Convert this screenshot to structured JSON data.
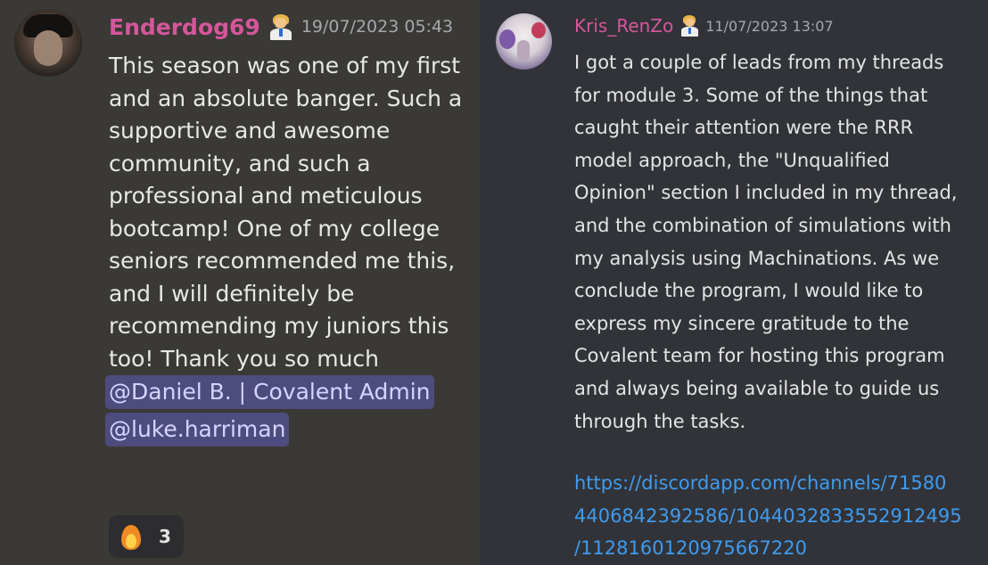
{
  "left_message": {
    "username": "Enderdog69",
    "role_icon": "scientist-emoji-icon",
    "timestamp": "19/07/2023 05:43",
    "body_lines": [
      "This season was one of my first",
      "and an absolute banger. Such a",
      "supportive and awesome",
      "community, and such a",
      "professional and meticulous",
      "bootcamp! One of my college",
      "seniors recommended me this,",
      "and I will definitely be",
      "recommending my juniors this",
      "too! Thank you so much"
    ],
    "mentions": [
      "@Daniel B. | Covalent Admin",
      "@luke.harriman"
    ],
    "reaction": {
      "emoji": "fire-emoji-icon",
      "count": "3"
    }
  },
  "right_message": {
    "username": "Kris_RenZo",
    "role_icon": "scientist-emoji-icon",
    "timestamp": "11/07/2023 13:07",
    "body_lines": [
      "I got a couple of leads from my threads",
      "for module 3. Some of the things that",
      "caught their attention were the RRR",
      "model approach, the \"Unqualified",
      "Opinion\" section I included in my thread,",
      "and the combination of simulations with",
      "my analysis using Machinations. As we",
      "conclude the program, I would like to",
      "express my sincere gratitude to the",
      "Covalent team for hosting this program",
      "and always being available to guide us",
      "through the tasks."
    ],
    "link_lines": [
      "https://discordapp.com/channels/71580",
      "4406842392586/1044032833552912495",
      "/1128160120975667220"
    ]
  },
  "colors": {
    "left_bg": "#3a3935",
    "right_bg": "#313338",
    "username": "#d4579b",
    "timestamp": "#a5a8ad",
    "mention_bg": "#4e4c7e",
    "mention_text": "#d2d5ff",
    "link": "#3f9bef"
  }
}
